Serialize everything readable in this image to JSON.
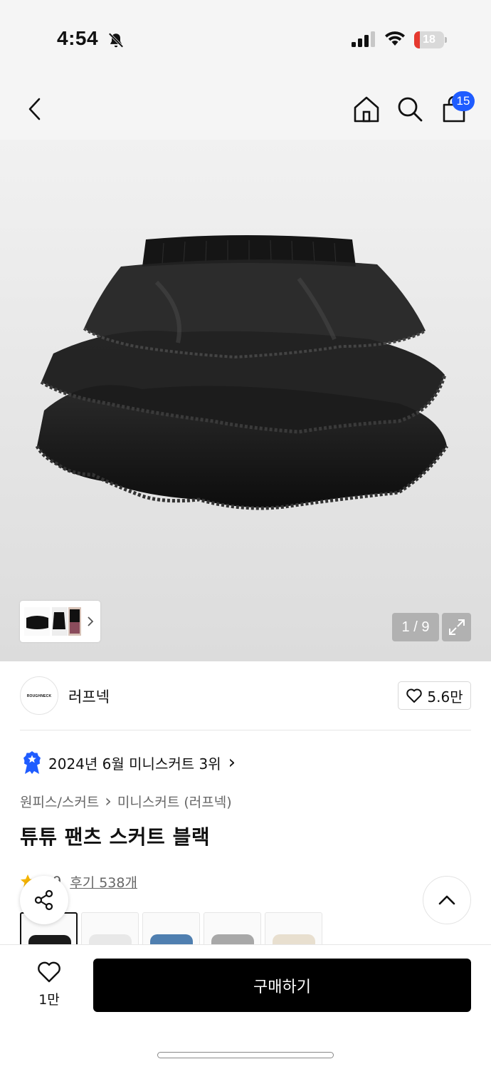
{
  "status_bar": {
    "time": "4:54",
    "battery_level": "18",
    "battery_fraction": 0.18
  },
  "nav": {
    "cart_count": "15",
    "icons": [
      "back-icon",
      "home-icon",
      "search-icon",
      "cart-icon"
    ]
  },
  "gallery": {
    "page_indicator": "1 / 9",
    "current_index": 1,
    "total_images": 9
  },
  "brand": {
    "logo_text": "ROUGHNECK",
    "name": "러프넥",
    "likes": "5.6만"
  },
  "ranking": {
    "text": "2024년 6월 미니스커트 3위",
    "chevron": "›"
  },
  "breadcrumb": {
    "category": "원피스/스커트",
    "separator": "›",
    "subcategory": "미니스커트 (러프넥)"
  },
  "product": {
    "title": "튜튜 팬츠 스커트 블랙",
    "rating": "4.9",
    "reviews_label": "후기 538개"
  },
  "color_swatches": [
    {
      "name": "black",
      "color": "#1a1a1a",
      "selected": true
    },
    {
      "name": "white",
      "color": "#e8e8e8",
      "selected": false
    },
    {
      "name": "blue",
      "color": "#4f7fb0",
      "selected": false
    },
    {
      "name": "gray",
      "color": "#a8a8a8",
      "selected": false
    },
    {
      "name": "ivory",
      "color": "#e8dfcf",
      "selected": false
    }
  ],
  "bottom_bar": {
    "wish_count": "1만",
    "buy_label": "구매하기"
  },
  "colors": {
    "accent_blue": "#1f5cff",
    "battery_red": "#e5392f",
    "buy_button": "#000000",
    "star": "#f5b400"
  }
}
